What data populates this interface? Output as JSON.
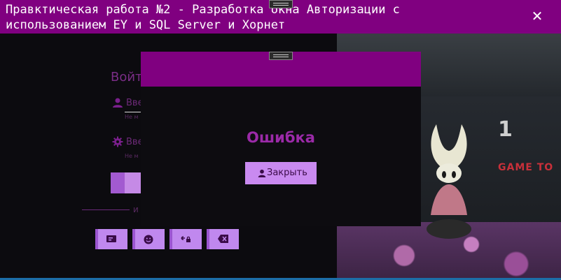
{
  "window": {
    "title": "Правктическая работа №2 - Разработка окна Авторизации с использованием EY и SQL Server и Хорнет",
    "close_symbol": "✕"
  },
  "login_form": {
    "title": "Войт",
    "login_placeholder": "Вве",
    "login_hint": "Не м",
    "password_placeholder": "Вве",
    "password_hint": "Не м",
    "or_text": "и"
  },
  "error_dialog": {
    "title": "Ошибка",
    "close_label": "Закрыть"
  },
  "background_photo": {
    "brand_text": "GAME TO",
    "logo_text": "1"
  },
  "icons": {
    "close": "close-icon",
    "user": "user-icon",
    "gear": "gear-icon",
    "card": "card-icon",
    "smile": "smile-icon",
    "link_lock": "link-lock-icon",
    "backspace": "backspace-icon"
  },
  "colors": {
    "accent": "#800080",
    "button": "#c98af0",
    "error_text": "#9b2aa8"
  }
}
